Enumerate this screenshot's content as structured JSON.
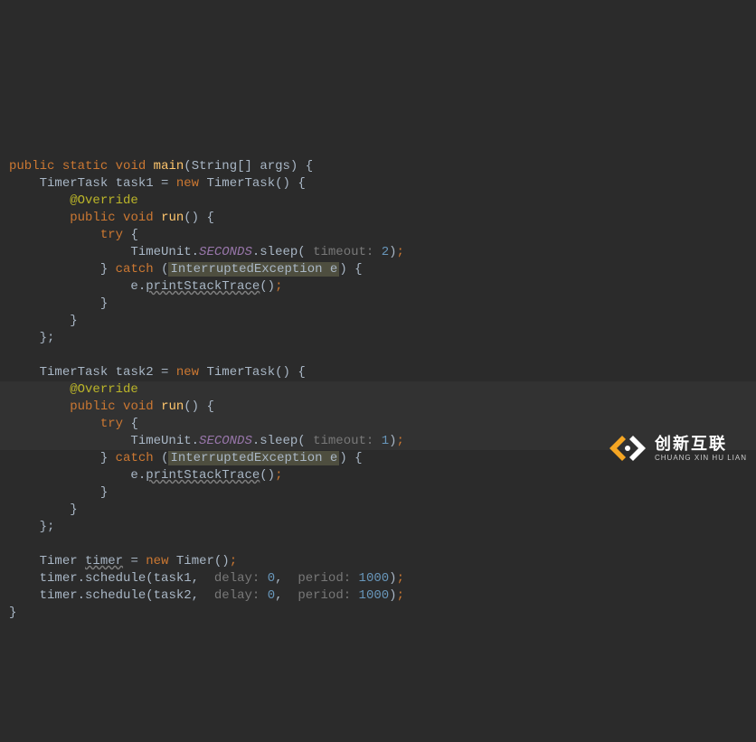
{
  "line1": {
    "kw_public": "public",
    "kw_static": "static",
    "kw_void": "void",
    "meth": "main",
    "lp": "(",
    "type": "String[]",
    "sp": " ",
    "arg": "args",
    "rp": ")",
    "ob": " {"
  },
  "line2": {
    "indent": "    ",
    "type": "TimerTask",
    "sp": " ",
    "var": "task1",
    "eq": " = ",
    "kw_new": "new",
    "sp2": " ",
    "ctor": "TimerTask",
    "par": "()",
    "ob": " {"
  },
  "line3": {
    "indent": "        ",
    "ann": "@Override"
  },
  "line4": {
    "indent": "        ",
    "kw_public": "public",
    "sp": " ",
    "kw_void": "void",
    "sp2": " ",
    "meth": "run",
    "par": "()",
    "ob": " {"
  },
  "line5": {
    "indent": "            ",
    "kw": "try",
    "ob": " {"
  },
  "line6": {
    "indent": "                ",
    "cls": "TimeUnit",
    "dot": ".",
    "field": "SECONDS",
    "dot2": ".",
    "meth": "sleep",
    "lp": "(",
    "hint": " timeout: ",
    "num": "2",
    "rp": ")",
    "semi": ";"
  },
  "line7": {
    "indent": "            ",
    "cb": "}",
    "sp": " ",
    "kw": "catch",
    "sp2": " ",
    "lp": "(",
    "box_type": "InterruptedException",
    "box_sp": " ",
    "box_var": "e",
    "rp": ")",
    "ob": " {"
  },
  "line8": {
    "indent": "                ",
    "var": "e",
    "dot": ".",
    "meth": "printStackTrace",
    "par": "()",
    "semi": ";"
  },
  "line9": {
    "indent": "            ",
    "cb": "}"
  },
  "line10": {
    "indent": "        ",
    "cb": "}"
  },
  "line11": {
    "indent": "    ",
    "cb": "};"
  },
  "line12": "",
  "line13": {
    "indent": "    ",
    "type": "TimerTask",
    "sp": " ",
    "var": "task2",
    "eq": " = ",
    "kw_new": "new",
    "sp2": " ",
    "ctor": "TimerTask",
    "par": "()",
    "ob": " {"
  },
  "line14": {
    "indent": "        ",
    "ann": "@Override"
  },
  "line15": {
    "indent": "        ",
    "kw_public": "public",
    "sp": " ",
    "kw_void": "void",
    "sp2": " ",
    "meth": "run",
    "par": "()",
    "ob": " {"
  },
  "line16": {
    "indent": "            ",
    "kw": "try",
    "ob": " {"
  },
  "line17": {
    "indent": "                ",
    "cls": "TimeUnit",
    "dot": ".",
    "field": "SECONDS",
    "dot2": ".",
    "meth": "sleep",
    "lp": "(",
    "hint": " timeout: ",
    "num": "1",
    "rp": ")",
    "semi": ";"
  },
  "line18": {
    "indent": "            ",
    "cb": "}",
    "sp": " ",
    "kw": "catch",
    "sp2": " ",
    "lp": "(",
    "box_type": "InterruptedException",
    "box_sp": " ",
    "box_var": "e",
    "rp": ")",
    "ob": " {"
  },
  "line19": {
    "indent": "                ",
    "var": "e",
    "dot": ".",
    "meth": "printStackTrace",
    "par": "()",
    "semi": ";"
  },
  "line20": {
    "indent": "            ",
    "cb": "}"
  },
  "line21": {
    "indent": "        ",
    "cb": "}"
  },
  "line22": {
    "indent": "    ",
    "cb": "};"
  },
  "line23": "",
  "line24": {
    "indent": "    ",
    "type": "Timer",
    "sp": " ",
    "var": "timer",
    "eq": " = ",
    "kw_new": "new",
    "sp2": " ",
    "ctor": "Timer",
    "par": "()",
    "semi": ";"
  },
  "line25": {
    "indent": "    ",
    "obj": "timer",
    "dot": ".",
    "meth": "schedule",
    "lp": "(",
    "arg1": "task1",
    "c1": ", ",
    "hint1": " delay: ",
    "n1": "0",
    "c2": ", ",
    "hint2": " period: ",
    "n2": "1000",
    "rp": ")",
    "semi": ";"
  },
  "line26": {
    "indent": "    ",
    "obj": "timer",
    "dot": ".",
    "meth": "schedule",
    "lp": "(",
    "arg1": "task2",
    "c1": ", ",
    "hint1": " delay: ",
    "n1": "0",
    "c2": ", ",
    "hint2": " period: ",
    "n2": "1000",
    "rp": ")",
    "semi": ";"
  },
  "line27": {
    "cb": "}"
  },
  "watermark": {
    "cn": "创新互联",
    "en": "CHUANG XIN HU LIAN"
  }
}
